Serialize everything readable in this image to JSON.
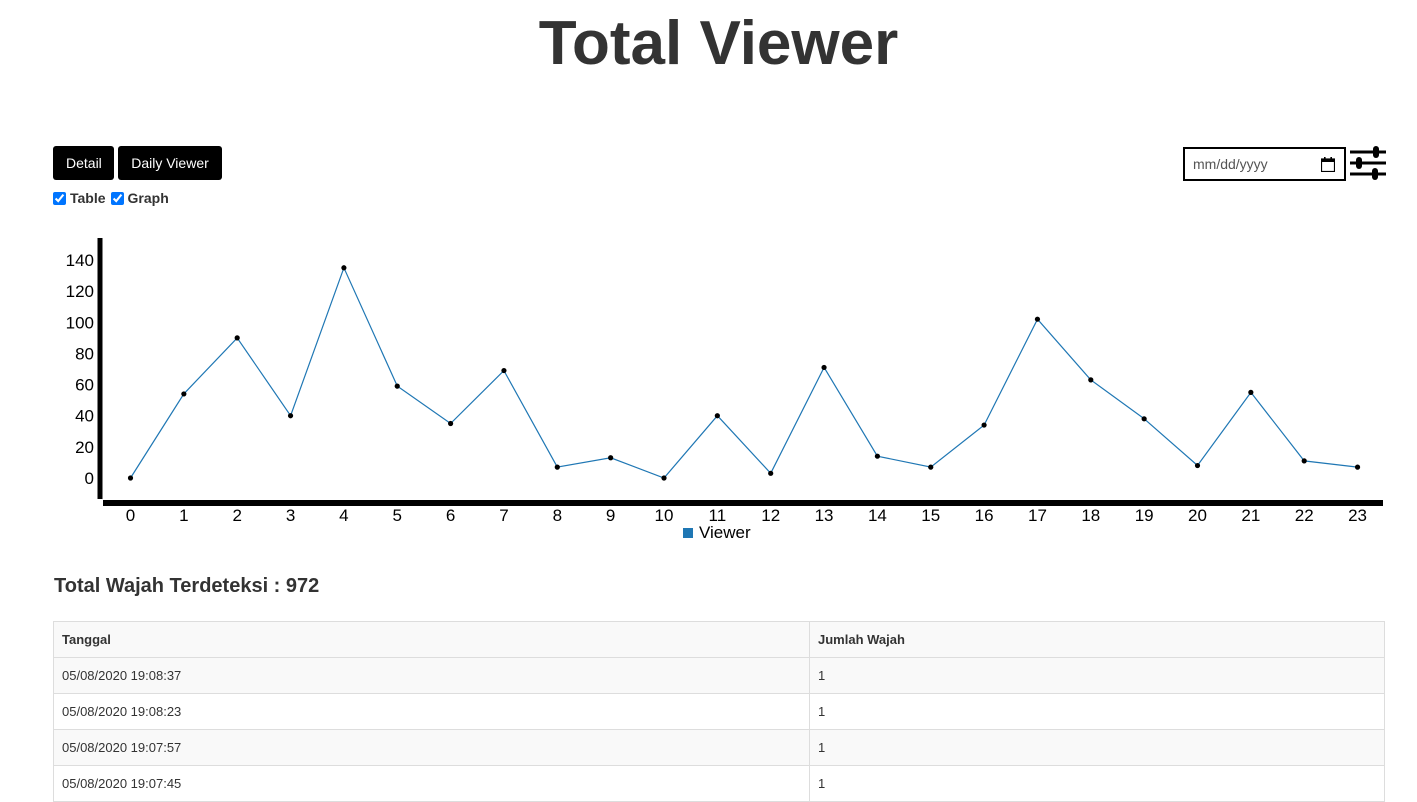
{
  "header": {
    "title": "Total Viewer"
  },
  "toolbar": {
    "detail_label": "Detail",
    "daily_viewer_label": "Daily Viewer",
    "table_checkbox_label": "Table",
    "table_checked": true,
    "graph_checkbox_label": "Graph",
    "graph_checked": true,
    "date_placeholder": "mm/dd/yyyy"
  },
  "icons": {
    "date": "calendar-icon",
    "filter": "sliders-icon"
  },
  "colors": {
    "line": "#1f77b4",
    "button_bg": "#000000",
    "text": "#333333"
  },
  "chart_data": {
    "type": "line",
    "x": [
      0,
      1,
      2,
      3,
      4,
      5,
      6,
      7,
      8,
      9,
      10,
      11,
      12,
      13,
      14,
      15,
      16,
      17,
      18,
      19,
      20,
      21,
      22,
      23
    ],
    "series": [
      {
        "name": "Viewer",
        "values": [
          0,
          54,
          90,
          40,
          135,
          59,
          35,
          69,
          7,
          13,
          0,
          40,
          3,
          71,
          14,
          7,
          34,
          102,
          63,
          38,
          8,
          55,
          11,
          7
        ]
      }
    ],
    "ylim": [
      0,
      140
    ],
    "yticks": [
      0,
      20,
      40,
      60,
      80,
      100,
      120,
      140
    ],
    "legend_position": "bottom-center",
    "grid": false,
    "title": "",
    "xlabel": "",
    "ylabel": ""
  },
  "summary": {
    "label": "Total Wajah Terdeteksi : 972"
  },
  "table": {
    "headers": [
      "Tanggal",
      "Jumlah Wajah"
    ],
    "rows": [
      [
        "05/08/2020 19:08:37",
        "1"
      ],
      [
        "05/08/2020 19:08:23",
        "1"
      ],
      [
        "05/08/2020 19:07:57",
        "1"
      ],
      [
        "05/08/2020 19:07:45",
        "1"
      ]
    ]
  }
}
